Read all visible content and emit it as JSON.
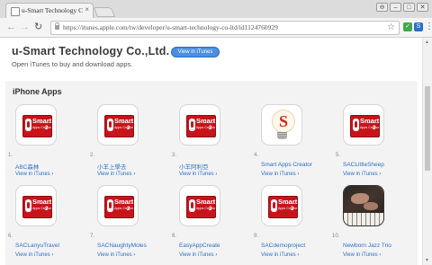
{
  "browser": {
    "tab_title": "u-Smart Technology Co.,Lt",
    "tab_close": "×",
    "url": "https://itunes.apple.com/tw/developer/u-smart-technology-co-ltd/id1124760929",
    "controls": {
      "user": "⊖",
      "minimize": "–",
      "maximize": "□",
      "close": "✕"
    },
    "nav": {
      "back": "←",
      "forward": "→",
      "reload": "↻",
      "star": "☆",
      "menu": "⋮"
    },
    "extensions": [
      "✓",
      "S"
    ]
  },
  "developer": {
    "name": "u-Smart Technology Co.,Ltd.",
    "itunes_button": "View in iTunes",
    "subtitle": "Open iTunes to buy and download apps."
  },
  "section": {
    "title": "iPhone Apps"
  },
  "apps": [
    {
      "num": "1.",
      "name": "ABC森林",
      "link": "View in iTunes ›",
      "icon": "smart-apps-creator-icon"
    },
    {
      "num": "2.",
      "name": "小羊上學去",
      "link": "View in iTunes ›",
      "icon": "smart-apps-creator-icon"
    },
    {
      "num": "3.",
      "name": "小羊阿利亞",
      "link": "View in iTunes ›",
      "icon": "smart-apps-creator-icon"
    },
    {
      "num": "4.",
      "name": "Smart Apps Creator",
      "link": "View in iTunes ›",
      "icon": "lightbulb-s-icon"
    },
    {
      "num": "5.",
      "name": "SACLittleSheep",
      "link": "View in iTunes ›",
      "icon": "smart-apps-creator-icon"
    },
    {
      "num": "6.",
      "name": "SACLanyuTravel",
      "link": "View in iTunes ›",
      "icon": "smart-apps-creator-icon"
    },
    {
      "num": "7.",
      "name": "SACNaughtyMoles",
      "link": "View in iTunes ›",
      "icon": "smart-apps-creator-icon"
    },
    {
      "num": "8.",
      "name": "EasyAppCreate",
      "link": "View in iTunes ›",
      "icon": "smart-apps-creator-icon"
    },
    {
      "num": "9.",
      "name": "SACdemoproject",
      "link": "View in iTunes ›",
      "icon": "smart-apps-creator-icon"
    },
    {
      "num": "10.",
      "name": "Newborn Jazz Trio",
      "link": "View in iTunes ›",
      "icon": "piano-photo-icon"
    }
  ],
  "icon_text": {
    "line1": "Smart",
    "line2": "Apps Creator",
    "line3": "2",
    "bulb_letter": "S"
  },
  "colors": {
    "link": "#2c6fc5",
    "icon_red": "#c7141b",
    "itunes_button": "#4a8fe0"
  }
}
